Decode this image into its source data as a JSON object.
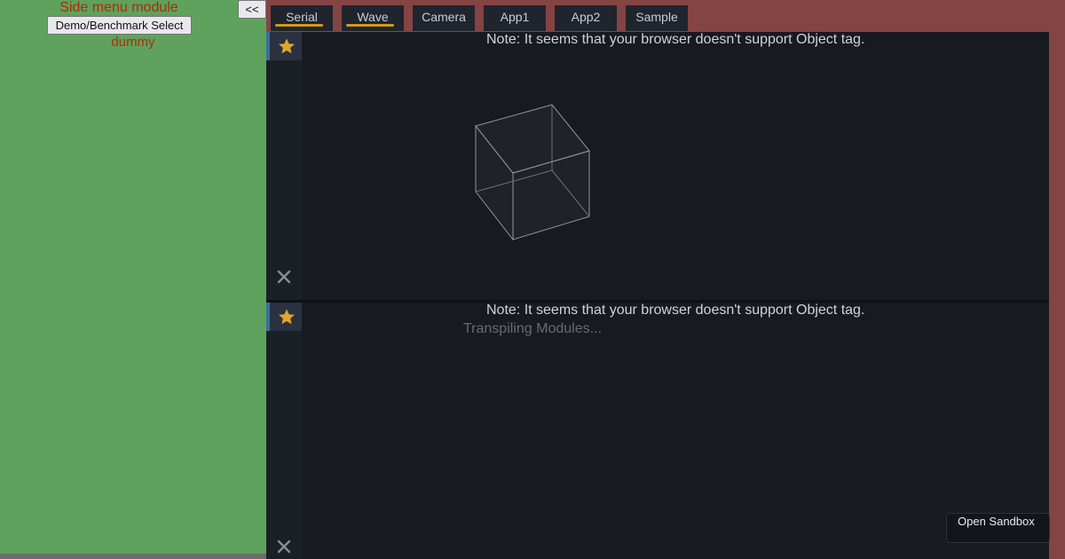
{
  "side_menu": {
    "title": "Side menu module",
    "demo_button_label": "Demo/Benchmark Select",
    "dummy_text": "dummy",
    "collapse_button_label": "<<"
  },
  "tabs": [
    {
      "label": "Serial",
      "active": true
    },
    {
      "label": "Wave",
      "active": true
    },
    {
      "label": "Camera",
      "active": false
    },
    {
      "label": "App1",
      "active": false
    },
    {
      "label": "App2",
      "active": false
    },
    {
      "label": "Sample",
      "active": false
    }
  ],
  "panels": [
    {
      "note": "Note: It seems that your browser doesn't support Object tag.",
      "content": "3d-cube"
    },
    {
      "note": "Note: It seems that your browser doesn't support Object tag.",
      "status": "Transpiling Modules..."
    }
  ],
  "sandbox_button_label": "Open Sandbox",
  "icons": {
    "star": "star-icon",
    "close": "close-icon"
  },
  "colors": {
    "side_menu_bg": "#5fa25d",
    "tab_bar_bg": "#844444",
    "panel_bg": "#171a20",
    "accent": "#d39a17",
    "side_text": "#b22a0a"
  }
}
